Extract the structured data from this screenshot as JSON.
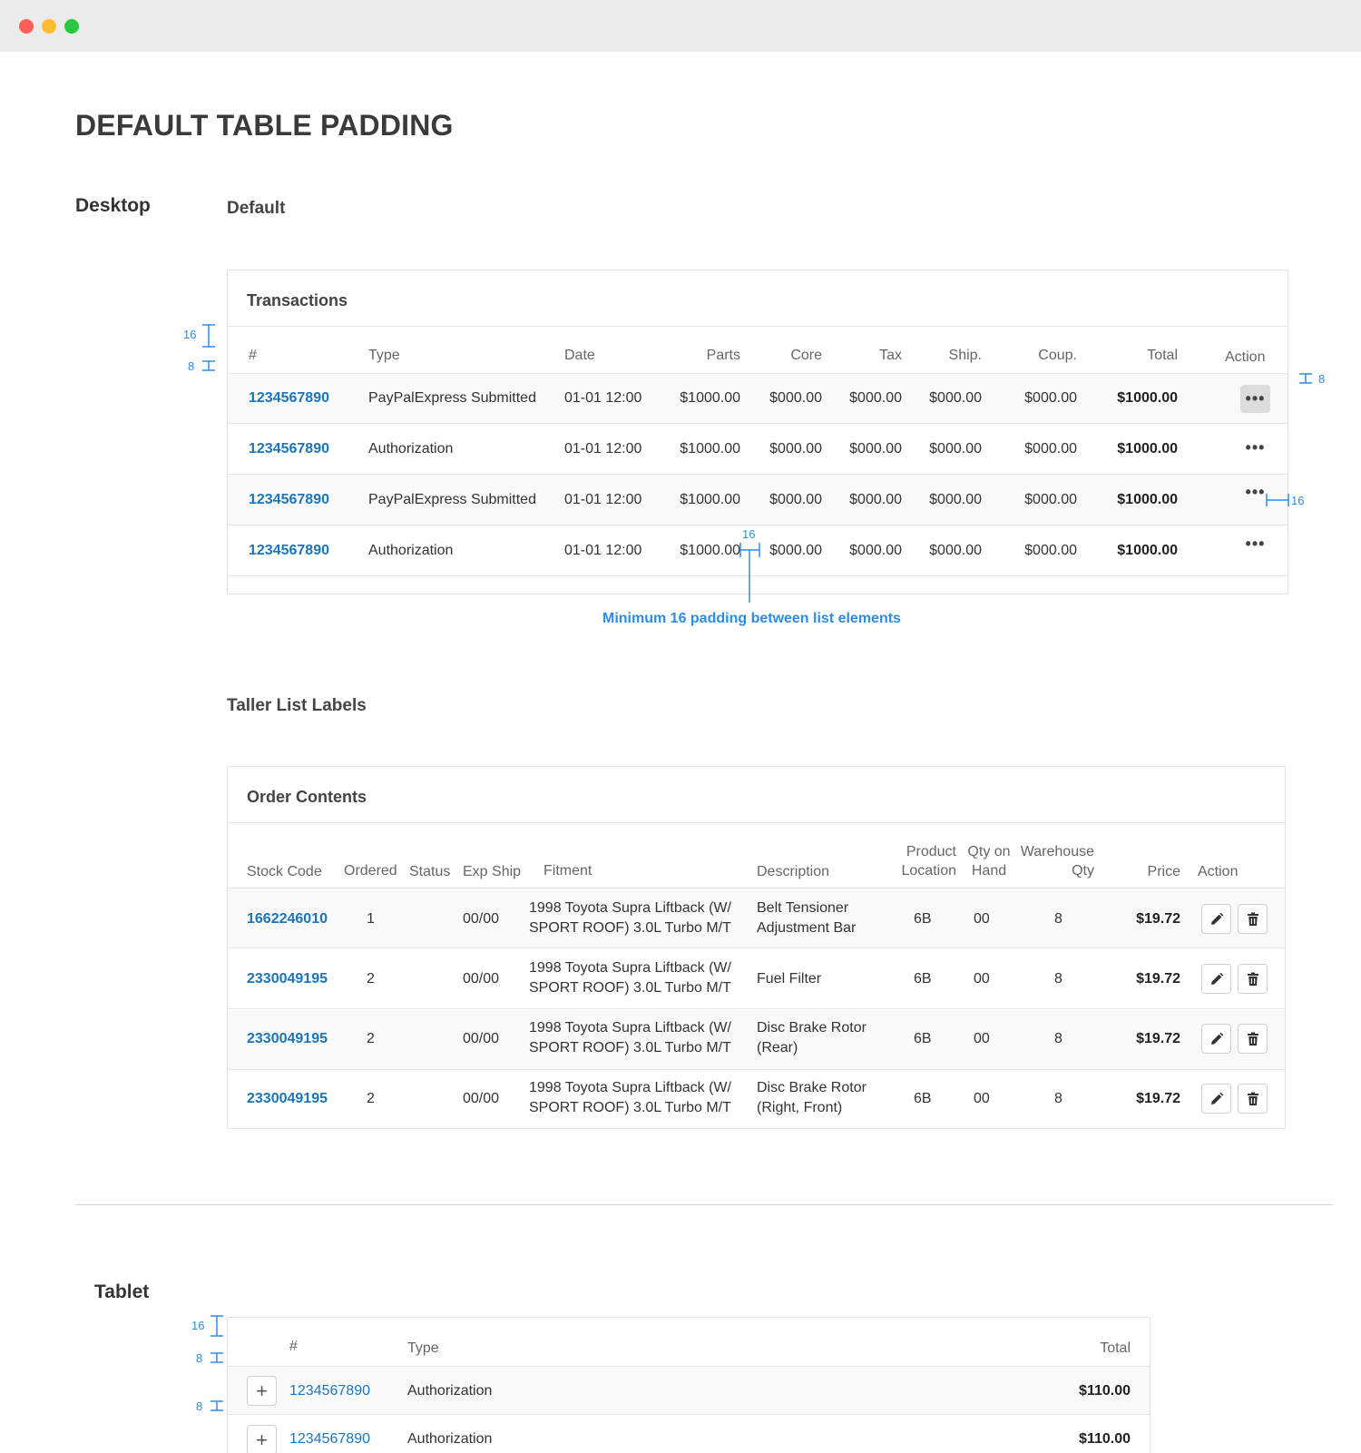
{
  "page": {
    "title": "DEFAULT TABLE PADDING",
    "desktop_label": "Desktop",
    "tablet_label": "Tablet"
  },
  "transactions": {
    "section_label": "Default",
    "card_title": "Transactions",
    "headers": [
      "#",
      "Type",
      "Date",
      "Parts",
      "Core",
      "Tax",
      "Ship.",
      "Coup.",
      "Total",
      "Action"
    ],
    "rows": [
      {
        "id": "1234567890",
        "type": "PayPalExpress Submitted",
        "date": "01-01 12:00",
        "parts": "$1000.00",
        "core": "$000.00",
        "tax": "$000.00",
        "ship": "$000.00",
        "coup": "$000.00",
        "total": "$1000.00",
        "action": "•••"
      },
      {
        "id": "1234567890",
        "type": "Authorization",
        "date": "01-01 12:00",
        "parts": "$1000.00",
        "core": "$000.00",
        "tax": "$000.00",
        "ship": "$000.00",
        "coup": "$000.00",
        "total": "$1000.00",
        "action": "•••"
      },
      {
        "id": "1234567890",
        "type": "PayPalExpress Submitted",
        "date": "01-01 12:00",
        "parts": "$1000.00",
        "core": "$000.00",
        "tax": "$000.00",
        "ship": "$000.00",
        "coup": "$000.00",
        "total": "$1000.00",
        "action": "•••"
      },
      {
        "id": "1234567890",
        "type": "Authorization",
        "date": "01-01 12:00",
        "parts": "$1000.00",
        "core": "$000.00",
        "tax": "$000.00",
        "ship": "$000.00",
        "coup": "$000.00",
        "total": "$1000.00",
        "action": "•••"
      }
    ],
    "annotations": {
      "top_padding": "16",
      "row_padding": "8",
      "right_padding": "8",
      "action_padding": "16",
      "column_gap": "16",
      "note": "Minimum 16 padding between list elements"
    }
  },
  "order_contents": {
    "section_label": "Taller List Labels",
    "card_title": "Order Contents",
    "headers": {
      "stock_code": "Stock Code",
      "ordered": "Ordered",
      "status": "Status",
      "exp_ship": "Exp Ship",
      "fitment": "Fitment",
      "description": "Description",
      "product_location_1": "Product",
      "product_location_2": "Location",
      "qty_on_hand_1": "Qty on",
      "qty_on_hand_2": "Hand",
      "warehouse_qty_1": "Warehouse",
      "warehouse_qty_2": "Qty",
      "price": "Price",
      "action": "Action"
    },
    "rows": [
      {
        "stock_code": "1662246010",
        "ordered": "1",
        "exp_ship": "00/00",
        "fitment": "1998 Toyota Supra Liftback (W/ SPORT ROOF) 3.0L Turbo M/T",
        "description": "Belt Tensioner Adjustment Bar",
        "location": "6B",
        "on_hand": "00",
        "warehouse": "8",
        "price": "$19.72"
      },
      {
        "stock_code": "2330049195",
        "ordered": "2",
        "exp_ship": "00/00",
        "fitment": "1998 Toyota Supra Liftback (W/ SPORT ROOF) 3.0L Turbo M/T",
        "description": "Fuel Filter",
        "location": "6B",
        "on_hand": "00",
        "warehouse": "8",
        "price": "$19.72"
      },
      {
        "stock_code": "2330049195",
        "ordered": "2",
        "exp_ship": "00/00",
        "fitment": "1998 Toyota Supra Liftback (W/ SPORT ROOF) 3.0L Turbo M/T",
        "description": "Disc Brake Rotor (Rear)",
        "location": "6B",
        "on_hand": "00",
        "warehouse": "8",
        "price": "$19.72"
      },
      {
        "stock_code": "2330049195",
        "ordered": "2",
        "exp_ship": "00/00",
        "fitment": "1998 Toyota Supra Liftback (W/ SPORT ROOF) 3.0L Turbo M/T",
        "description": "Disc Brake Rotor (Right, Front)",
        "location": "6B",
        "on_hand": "00",
        "warehouse": "8",
        "price": "$19.72"
      }
    ]
  },
  "tablet": {
    "headers": [
      "#",
      "Type",
      "Total"
    ],
    "rows": [
      {
        "expand": "+",
        "id": "1234567890",
        "type": "Authorization",
        "total": "$110.00"
      },
      {
        "expand": "+",
        "id": "1234567890",
        "type": "Authorization",
        "total": "$110.00"
      }
    ],
    "annotations": {
      "top_padding": "16",
      "row_padding_a": "8",
      "row_padding_b": "8"
    }
  },
  "colors": {
    "link": "#1b75bc",
    "annotation": "#2c8ce6",
    "border": "#e2e2e2"
  }
}
